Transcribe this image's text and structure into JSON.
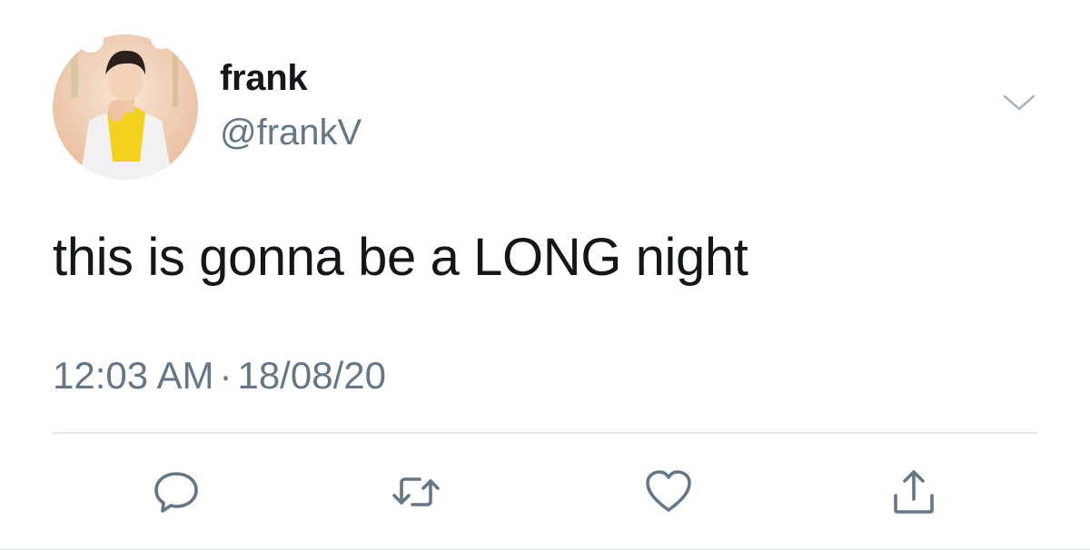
{
  "user": {
    "display_name": "frank",
    "handle": "@frankV"
  },
  "tweet": {
    "text": "this is gonna be a LONG night",
    "time": "12:03 AM",
    "separator": "·",
    "date": "18/08/20"
  },
  "icons": {
    "menu": "chevron-down-icon",
    "reply": "reply-icon",
    "retweet": "retweet-icon",
    "like": "heart-icon",
    "share": "share-icon"
  },
  "colors": {
    "text": "#14171a",
    "secondary": "#657786",
    "icon": "#657786",
    "divider": "#e1e8ed"
  }
}
